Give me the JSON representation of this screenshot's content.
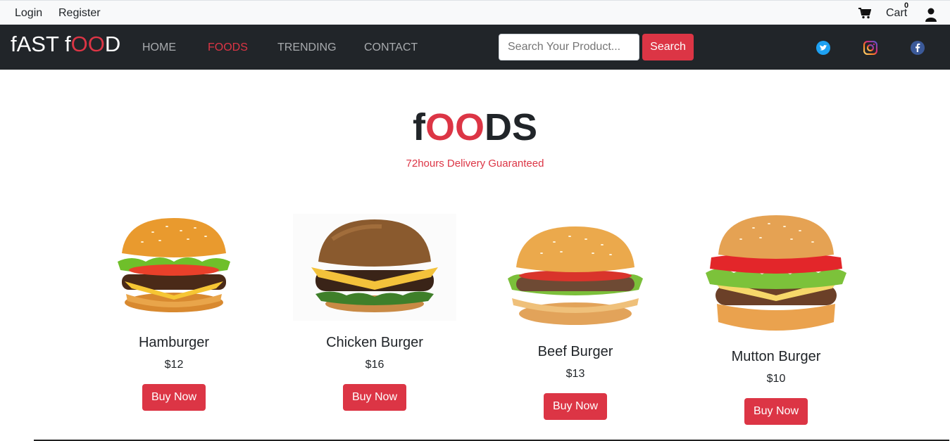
{
  "topbar": {
    "login": "Login",
    "register": "Register",
    "cart_label": "Cart",
    "cart_count": "0"
  },
  "navbar": {
    "brand_part1": "fAST f",
    "brand_part2": "OO",
    "brand_part3": "D",
    "links": [
      "HOME",
      "FOODS",
      "TRENDING",
      "CONTACT"
    ],
    "active_link": "FOODS",
    "search_placeholder": "Search Your Product...",
    "search_button": "Search",
    "social_icons": [
      "twitter-icon",
      "instagram-icon",
      "facebook-icon"
    ]
  },
  "section": {
    "title_part1": "f",
    "title_part2": "OO",
    "title_part3": "DS",
    "subtitle": "72hours Delivery Guaranteed"
  },
  "products": [
    {
      "name": "Hamburger",
      "price": "$12",
      "button": "Buy Now"
    },
    {
      "name": "Chicken Burger",
      "price": "$16",
      "button": "Buy Now"
    },
    {
      "name": "Beef Burger",
      "price": "$13",
      "button": "Buy Now"
    },
    {
      "name": "Mutton Burger",
      "price": "$10",
      "button": "Buy Now"
    }
  ],
  "colors": {
    "accent": "#dc3545",
    "navbar_bg": "#212529",
    "topbar_bg": "#f8f9fa"
  }
}
